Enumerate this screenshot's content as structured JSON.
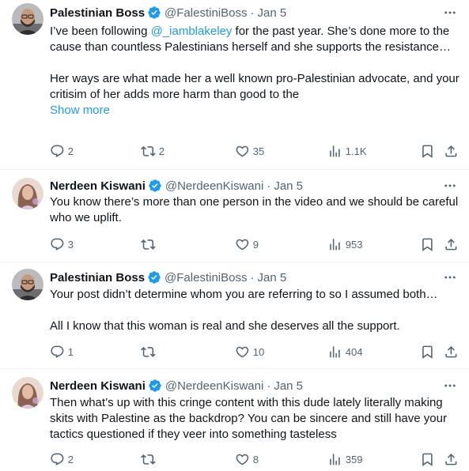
{
  "tweets": [
    {
      "author": "Palestinian Boss",
      "handle": "@FalestiniBoss",
      "separator": "·",
      "date": "Jan 5",
      "mention": "@_iamblakeley",
      "text_before_mention": "I’ve been following ",
      "text_after_mention": " for the past year. She’s done more to the cause than countless Palestinians herself and she supports the resistance…",
      "paragraph2": "Her ways are what made her a well known pro-Palestinian advocate, and your critisim of her adds more harm than good to the",
      "show_more": "Show more",
      "replies": "2",
      "reposts": "2",
      "likes": "35",
      "views": "1.1K"
    },
    {
      "author": "Nerdeen Kiswani",
      "handle": "@NerdeenKiswani",
      "separator": "·",
      "date": "Jan 5",
      "paragraph1": "You know there’s more than one person in the video and we should be careful who we uplift.",
      "replies": "3",
      "reposts": "",
      "likes": "9",
      "views": "953"
    },
    {
      "author": "Palestinian Boss",
      "handle": "@FalestiniBoss",
      "separator": "·",
      "date": "Jan 5",
      "paragraph1": "Your post didn’t determine whom you are referring to so I assumed both…",
      "paragraph2": "All I know that this woman is real and she deserves all the support.",
      "replies": "1",
      "reposts": "",
      "likes": "10",
      "views": "404"
    },
    {
      "author": "Nerdeen Kiswani",
      "handle": "@NerdeenKiswani",
      "separator": "·",
      "date": "Jan 5",
      "paragraph1": "Then what’s up with this cringe content with this dude lately literally making skits with Palestine as the backdrop? You can be sincere and still have your tactics questioned if they veer into something tasteless",
      "replies": "2",
      "reposts": "",
      "likes": "8",
      "views": "359"
    }
  ],
  "icons": {
    "more": "more-horizontal-icon",
    "reply": "reply-icon",
    "repost": "repost-icon",
    "like": "heart-icon",
    "views": "views-icon",
    "bookmark": "bookmark-icon",
    "share": "share-icon",
    "verified": "verified-badge-icon"
  },
  "colors": {
    "link": "#1d9bf0",
    "secondary_text": "#536471",
    "verified": "#1d9bf0"
  }
}
